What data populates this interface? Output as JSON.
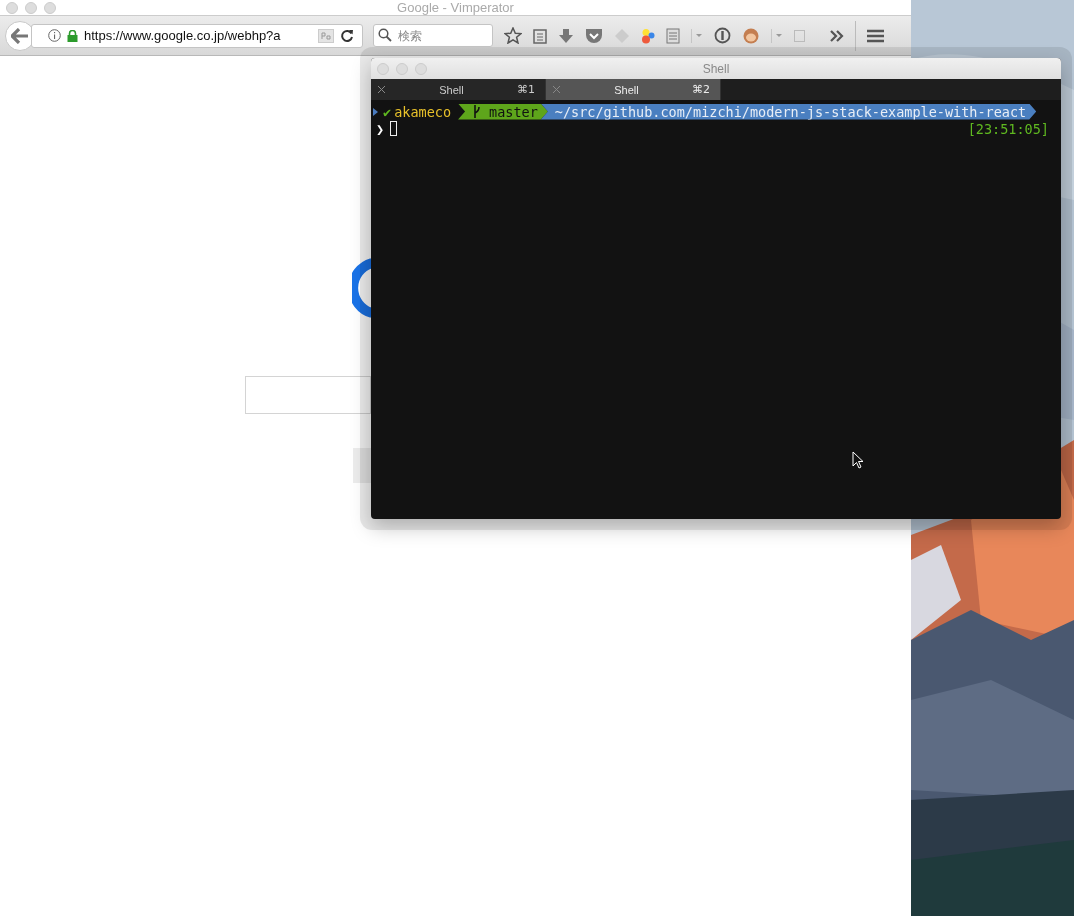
{
  "browser": {
    "title": "Google - Vimperator",
    "url": "https://www.google.co.jp/webhp?a",
    "search": {
      "placeholder": "検索"
    }
  },
  "terminal": {
    "title": "Shell",
    "tabs": [
      {
        "label": "Shell",
        "shortcut": "⌘1",
        "selected": false
      },
      {
        "label": "Shell",
        "shortcut": "⌘2",
        "selected": true
      }
    ],
    "prompt": {
      "status": "✔",
      "user": "akameco",
      "branch": "master",
      "path": "~/src/github.com/mizchi/modern-js-stack-example-with-react",
      "symbol": "❯",
      "time": "[23:51:05]"
    }
  }
}
